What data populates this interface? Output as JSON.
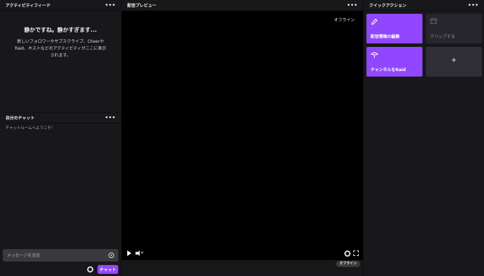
{
  "activity_feed": {
    "title": "アクティビティフィード",
    "more": "•••",
    "empty_title": "静かですね。静かすぎます...",
    "empty_desc": "新しいフォロワーやサブスクライブ、CheerやRaid、ホストなどのアクティビティがここに表示されます。"
  },
  "chat": {
    "title": "自分のチャット",
    "more": "•••",
    "welcome": "チャットルームへようこそ！",
    "input_placeholder": "メッセージを送信",
    "send_label": "チャット"
  },
  "preview": {
    "title": "配信プレビュー",
    "more": "•••",
    "offline_overlay": "オフライン",
    "status_badge": "オフライン"
  },
  "quick_actions": {
    "title": "クイックアクション",
    "more": "•••",
    "tiles": [
      {
        "label": "配信情報の編集",
        "icon": "pencil-icon"
      },
      {
        "label": "クリップする",
        "icon": "clapper-icon"
      },
      {
        "label": "チャンネルをRaid",
        "icon": "raid-icon"
      },
      {
        "label": "+",
        "icon": "plus-icon"
      }
    ]
  },
  "colors": {
    "accent": "#9147ff",
    "background": "#0e0e10",
    "panel": "#18181b"
  }
}
